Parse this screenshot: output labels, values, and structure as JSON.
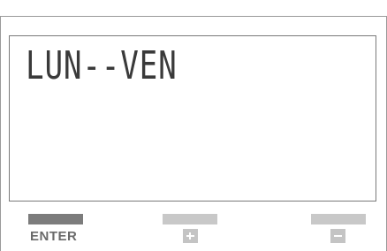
{
  "display": {
    "text": "LUN--VEN"
  },
  "keys": {
    "enter_label": "ENTER",
    "plus_icon": "plus-icon",
    "minus_icon": "minus-icon"
  },
  "colors": {
    "enter_bar": "#7c7c7c",
    "other_bars": "#c8c8c8",
    "lcd_text": "#3a3a3a"
  }
}
